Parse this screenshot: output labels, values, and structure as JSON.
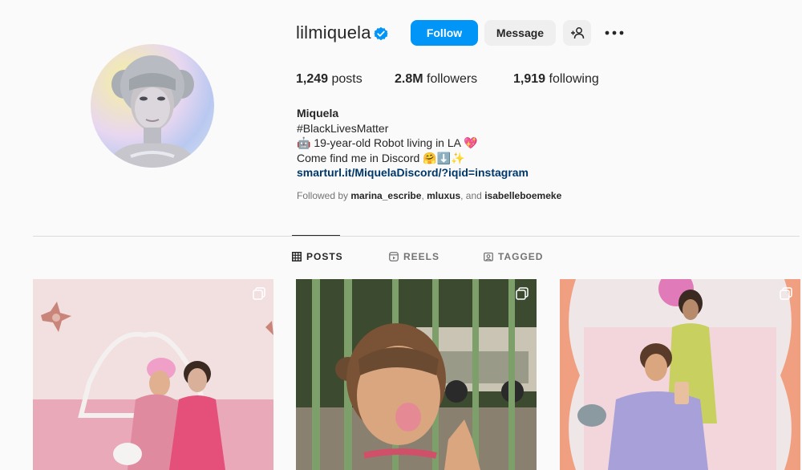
{
  "profile": {
    "username": "lilmiquela",
    "follow_label": "Follow",
    "message_label": "Message",
    "stats": {
      "posts_count": "1,249",
      "posts_label": "posts",
      "followers_count": "2.8M",
      "followers_label": "followers",
      "following_count": "1,919",
      "following_label": "following"
    },
    "bio": {
      "name": "Miquela",
      "line1": "#BlackLivesMatter",
      "line2": "🤖 19-year-old Robot living in LA 💖",
      "line3": "Come find me in Discord 🤗⬇️✨",
      "link": "smarturl.it/MiquelaDiscord/?iqid=instagram"
    },
    "followed_by": {
      "prefix": "Followed by",
      "user1": "marina_escribe",
      "sep1": ",",
      "user2": "mluxus",
      "sep2": ", and",
      "user3": "isabelleboemeke"
    }
  },
  "tabs": [
    {
      "label": "POSTS",
      "active": true,
      "icon": "grid-icon"
    },
    {
      "label": "REELS",
      "active": false,
      "icon": "reels-icon"
    },
    {
      "label": "TAGGED",
      "active": false,
      "icon": "tagged-icon"
    }
  ],
  "posts": [
    {
      "icon": "multiple-posts-icon"
    },
    {
      "icon": "multiple-posts-icon"
    },
    {
      "icon": "multiple-posts-icon"
    }
  ],
  "colors": {
    "accent": "#0095f6",
    "link": "#00376b",
    "verified": "#0095f6"
  }
}
